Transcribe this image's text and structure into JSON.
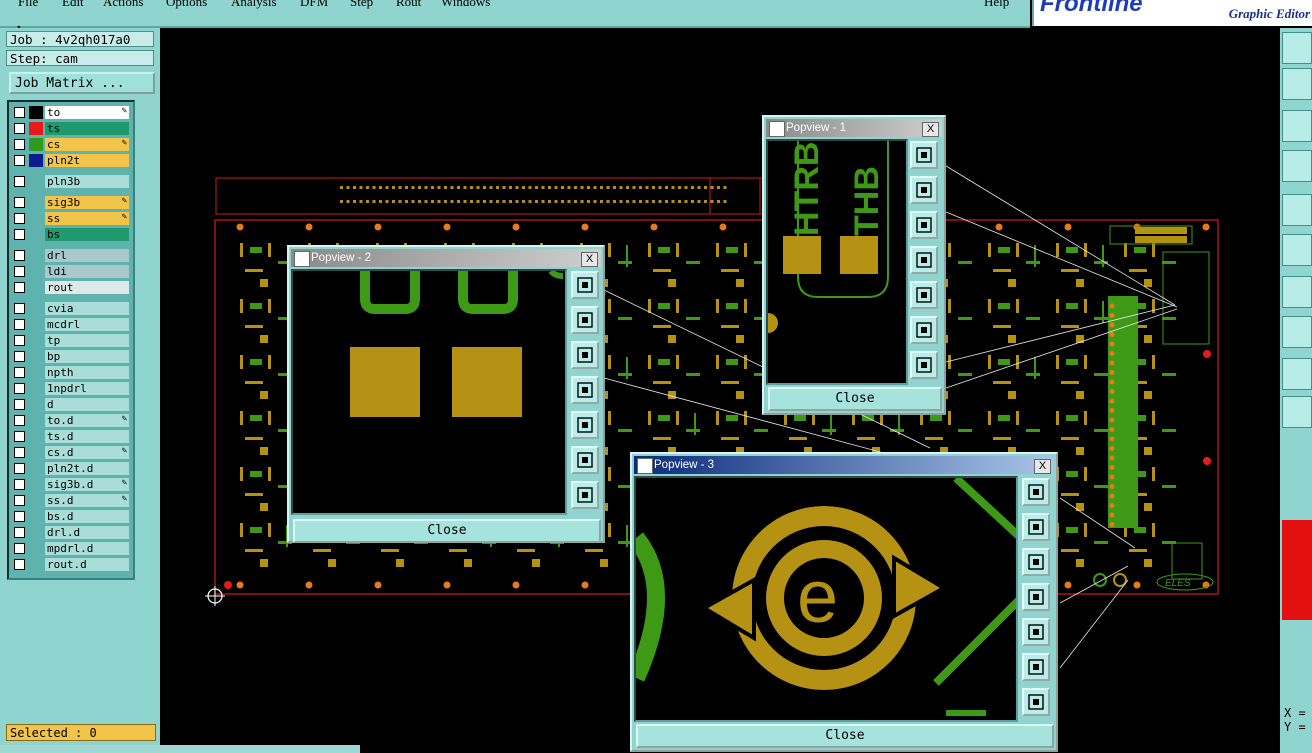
{
  "menubar": {
    "items": [
      "File",
      "Edit",
      "Actions",
      "Options",
      "Analysis",
      "DFM",
      "Step",
      "Rout",
      "Windows"
    ],
    "help": "Help"
  },
  "brand": {
    "logo": "Frontline",
    "subtitle": "Graphic Editor"
  },
  "job": {
    "job_label": "Job : 4v2qh017a0",
    "step_label": "Step: cam",
    "job_matrix_button": "Job Matrix ..."
  },
  "layers": [
    {
      "name": "to",
      "swatch": "#000000",
      "bg": "#ffffff",
      "edit": true
    },
    {
      "name": "ts",
      "swatch": "#e81b1b",
      "bg": "#1e9a6e",
      "edit": false
    },
    {
      "name": "cs",
      "swatch": "#2f9a1c",
      "bg": "#f2c44a",
      "edit": true
    },
    {
      "name": "pln2t",
      "swatch": "#0b1d8a",
      "bg": "#f2c44a",
      "edit": false
    },
    {
      "name": "pln3b",
      "swatch": "",
      "bg": "#a8ddd8",
      "edit": false
    },
    {
      "name": "sig3b",
      "swatch": "",
      "bg": "#f2c44a",
      "edit": true
    },
    {
      "name": "ss",
      "swatch": "",
      "bg": "#f2c44a",
      "edit": true
    },
    {
      "name": "bs",
      "swatch": "",
      "bg": "#1e9a6e",
      "edit": false
    },
    {
      "name": "drl",
      "swatch": "",
      "bg": "#a8c8cc",
      "edit": false
    },
    {
      "name": "ldi",
      "swatch": "",
      "bg": "#a8c8cc",
      "edit": false
    },
    {
      "name": "rout",
      "swatch": "",
      "bg": "#dfe8e8",
      "edit": false
    },
    {
      "name": "cvia",
      "swatch": "",
      "bg": "#a8ddd8",
      "edit": false
    },
    {
      "name": "mcdrl",
      "swatch": "",
      "bg": "#a8ddd8",
      "edit": false
    },
    {
      "name": "tp",
      "swatch": "",
      "bg": "#a8ddd8",
      "edit": false
    },
    {
      "name": "bp",
      "swatch": "",
      "bg": "#a8ddd8",
      "edit": false
    },
    {
      "name": "npth",
      "swatch": "",
      "bg": "#a8ddd8",
      "edit": false
    },
    {
      "name": "1npdrl",
      "swatch": "",
      "bg": "#a8ddd8",
      "edit": false
    },
    {
      "name": "d",
      "swatch": "",
      "bg": "#a8ddd8",
      "edit": false
    },
    {
      "name": "to.d",
      "swatch": "",
      "bg": "#a8ddd8",
      "edit": true
    },
    {
      "name": "ts.d",
      "swatch": "",
      "bg": "#a8ddd8",
      "edit": false
    },
    {
      "name": "cs.d",
      "swatch": "",
      "bg": "#a8ddd8",
      "edit": true
    },
    {
      "name": "pln2t.d",
      "swatch": "",
      "bg": "#a8ddd8",
      "edit": false
    },
    {
      "name": "sig3b.d",
      "swatch": "",
      "bg": "#a8ddd8",
      "edit": true
    },
    {
      "name": "ss.d",
      "swatch": "",
      "bg": "#a8ddd8",
      "edit": true
    },
    {
      "name": "bs.d",
      "swatch": "",
      "bg": "#a8ddd8",
      "edit": false
    },
    {
      "name": "drl.d",
      "swatch": "",
      "bg": "#a8ddd8",
      "edit": false
    },
    {
      "name": "mpdrl.d",
      "swatch": "",
      "bg": "#a8ddd8",
      "edit": false
    },
    {
      "name": "rout.d",
      "swatch": "",
      "bg": "#a8ddd8",
      "edit": false
    }
  ],
  "status": {
    "selected": "Selected : 0",
    "x_label": "X =",
    "y_label": "Y ="
  },
  "popups": [
    {
      "title": "Popview - 1",
      "close": "Close",
      "close_x": "X",
      "text1": "HTRB",
      "text2": "THB"
    },
    {
      "title": "Popview - 2",
      "close": "Close",
      "close_x": "X"
    },
    {
      "title": "Popview - 3",
      "close": "Close",
      "close_x": "X",
      "glyph": "e"
    }
  ],
  "board": {
    "logo_text": "ELES"
  },
  "colors": {
    "panel": "#8fd4cf",
    "copper_gold": "#b59214",
    "trace_green": "#3e9a16",
    "board_outline": "#d11a1a"
  }
}
